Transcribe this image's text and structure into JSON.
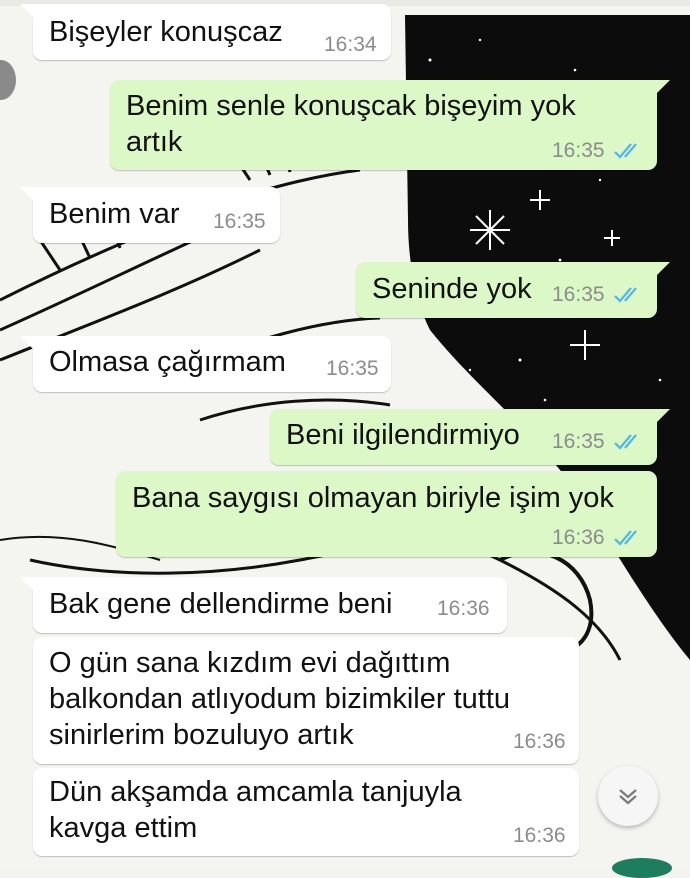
{
  "chat": {
    "messages": [
      {
        "text": "Bişeyler konuşcaz",
        "time": "16:34"
      },
      {
        "text": "Benim senle konuşcak bişeyim yok\nartık",
        "time": "16:35",
        "status": "read"
      },
      {
        "text": "Benim var",
        "time": "16:35"
      },
      {
        "text": "Seninde yok",
        "time": "16:35",
        "status": "read"
      },
      {
        "text": "Olmasa çağırmam",
        "time": "16:35"
      },
      {
        "text": "Beni ilgilendirmiyo",
        "time": "16:35",
        "status": "read"
      },
      {
        "text": "Bana saygısı olmayan biriyle işim yok",
        "time": "16:36",
        "status": "read"
      },
      {
        "text": "Bak gene dellendirme beni",
        "time": "16:36"
      },
      {
        "text": "O gün sana kızdım evi dağıttım\nbalkondan atlıyodum bizimkiler tuttu\nsinirlerim bozuluyo artık",
        "time": "16:36"
      },
      {
        "text": "Dün akşamda amcamla tanjuyla\nkavga ettim",
        "time": "16:36"
      }
    ]
  },
  "colors": {
    "incoming_bubble": "#ffffff",
    "outgoing_bubble": "#dcf8c6",
    "read_ticks": "#4fb6ec",
    "timestamp": "#8c8c8c"
  },
  "icons": {
    "scroll_down": "chevron-down-icon",
    "read_receipt": "double-check-icon"
  }
}
